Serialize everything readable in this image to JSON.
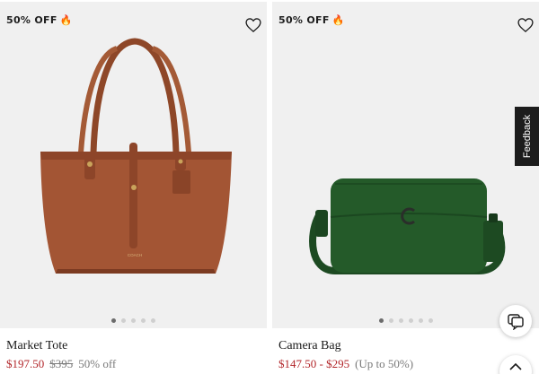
{
  "products": [
    {
      "badge": "50% OFF",
      "badge_icon": "flame-icon",
      "name": "Market Tote",
      "sale_price": "$197.50",
      "original_price": "$395",
      "discount": "50% off",
      "image": "brown-leather-tote-bag",
      "carousel_dots": 5,
      "active_dot": 1
    },
    {
      "badge": "50% OFF",
      "badge_icon": "flame-icon",
      "name": "Camera Bag",
      "sale_price": "$147.50 - $295",
      "discount": "(Up to 50%)",
      "image": "green-leather-camera-bag",
      "carousel_dots": 6,
      "active_dot": 1
    }
  ],
  "feedback": {
    "label": "Feedback"
  },
  "floating": {
    "chat_icon": "chat-icon",
    "scroll_icon": "chevron-up-icon"
  },
  "colors": {
    "sale_price": "#b2262a",
    "muted_text": "#7a7a7a",
    "card_bg": "#f0f0f0",
    "badge_flame": "#f06b1a",
    "feedback_bg": "#1c1c1c"
  }
}
